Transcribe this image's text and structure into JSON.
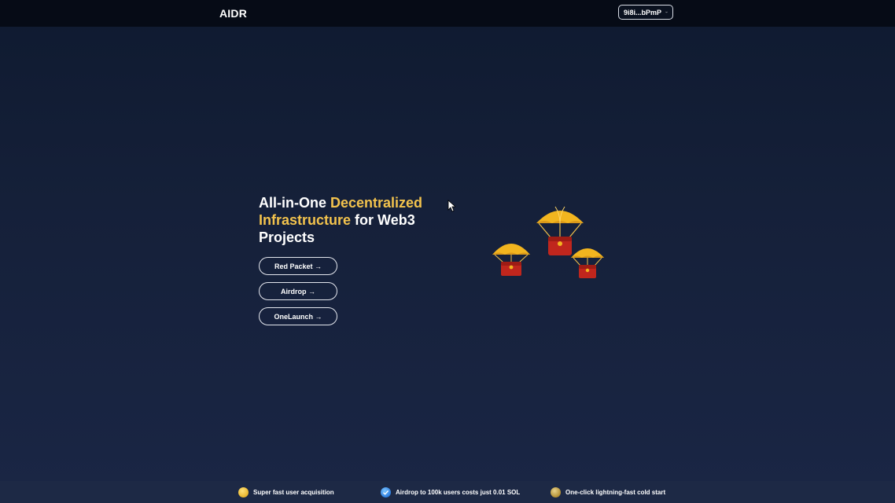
{
  "header": {
    "logo": "AIDR",
    "wallet_label": "9i8i...bPmP"
  },
  "hero": {
    "title_part1": "All-in-One ",
    "title_highlight": "Decentralized Infrastructure",
    "title_part2": " for Web3 Projects",
    "buttons": [
      {
        "label": "Red Packet →"
      },
      {
        "label": "Airdrop →"
      },
      {
        "label": "OneLaunch →"
      }
    ]
  },
  "footer": {
    "features": [
      {
        "text": "Super fast user acquisition",
        "icon": "gold-coin-icon"
      },
      {
        "text": "Airdrop to 100k users costs just 0.01 SOL",
        "icon": "check-badge-icon"
      },
      {
        "text": "One-click lightning-fast cold start",
        "icon": "coin-icon"
      }
    ]
  },
  "colors": {
    "accent": "#f3c34d",
    "background": "#152039",
    "topbar": "#060b16"
  }
}
